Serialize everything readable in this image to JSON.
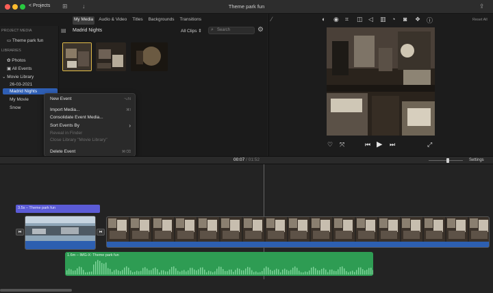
{
  "window": {
    "title": "Theme park fun",
    "projects_label": "< Projects"
  },
  "library_tabs": [
    {
      "label": "My Media",
      "active": true
    },
    {
      "label": "Audio & Video",
      "active": false
    },
    {
      "label": "Titles",
      "active": false
    },
    {
      "label": "Backgrounds",
      "active": false
    },
    {
      "label": "Transitions",
      "active": false
    }
  ],
  "sidebar": {
    "project_media_header": "PROJECT MEDIA",
    "project_item": "Theme park fun",
    "libraries_header": "LIBRARIES",
    "photos": "Photos",
    "all_events": "All Events",
    "movie_library": "Movie Library",
    "date_event": "26-03-2021",
    "madrid": "Madrid Nights",
    "my_movie": "My Movie",
    "snow": "Snow"
  },
  "events": {
    "title": "Madrid Nights",
    "filter": "All Clips ⇕",
    "search_placeholder": "Search"
  },
  "context_menu": {
    "items": [
      {
        "label": "New Event",
        "shortcut": "⌥N",
        "disabled": false
      },
      {
        "label": "Import Media...",
        "shortcut": "⌘I",
        "disabled": false
      },
      {
        "label": "Consolidate Event Media...",
        "shortcut": "",
        "disabled": false
      },
      {
        "label": "Sort Events By",
        "shortcut": "›",
        "disabled": false
      },
      {
        "label": "Reveal in Finder",
        "shortcut": "",
        "disabled": true
      },
      {
        "label": "Close Library \"Movie Library\"",
        "shortcut": "",
        "disabled": true
      },
      {
        "label": "Delete Event",
        "shortcut": "⌘⌫",
        "disabled": false
      }
    ]
  },
  "viewer": {
    "reset_all": "Reset All"
  },
  "timeline": {
    "current": "00:07",
    "total": "01:52",
    "separator": " / ",
    "settings_label": "Settings",
    "title_clip_label": "3.5s – Theme park fun",
    "audio_clip_label": "1.6m – IMG-X: Theme park fun",
    "volume_fraction": 0.55
  },
  "colors": {
    "accent": "#2f5fb5",
    "title_clip": "#5b5bd6",
    "audio_clip": "#2e9c53",
    "video_track": "#2d5fb0"
  }
}
